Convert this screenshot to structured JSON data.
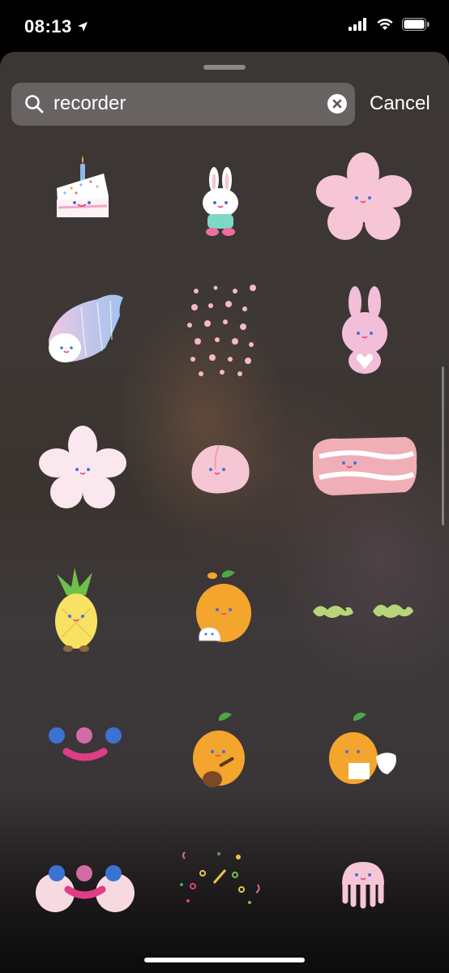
{
  "status": {
    "time": "08:13"
  },
  "search": {
    "query": "recorder",
    "cancel_label": "Cancel"
  },
  "stickers": [
    {
      "name": "birthday-cake-sticker"
    },
    {
      "name": "bunny-sticker"
    },
    {
      "name": "pink-cherry-blossom-sticker"
    },
    {
      "name": "seashell-sticker"
    },
    {
      "name": "falling-blossoms-sticker"
    },
    {
      "name": "pink-bunny-heart-sticker"
    },
    {
      "name": "white-blossom-sticker"
    },
    {
      "name": "peach-sticker"
    },
    {
      "name": "bacon-sticker"
    },
    {
      "name": "pineapple-sticker"
    },
    {
      "name": "orange-dumpling-sticker"
    },
    {
      "name": "green-worms-sticker"
    },
    {
      "name": "smiley-face-sticker"
    },
    {
      "name": "orange-guitar-sticker"
    },
    {
      "name": "orange-letter-sticker"
    },
    {
      "name": "smiley-cheeks-sticker"
    },
    {
      "name": "confetti-sticker"
    },
    {
      "name": "jellyfish-sticker"
    }
  ]
}
